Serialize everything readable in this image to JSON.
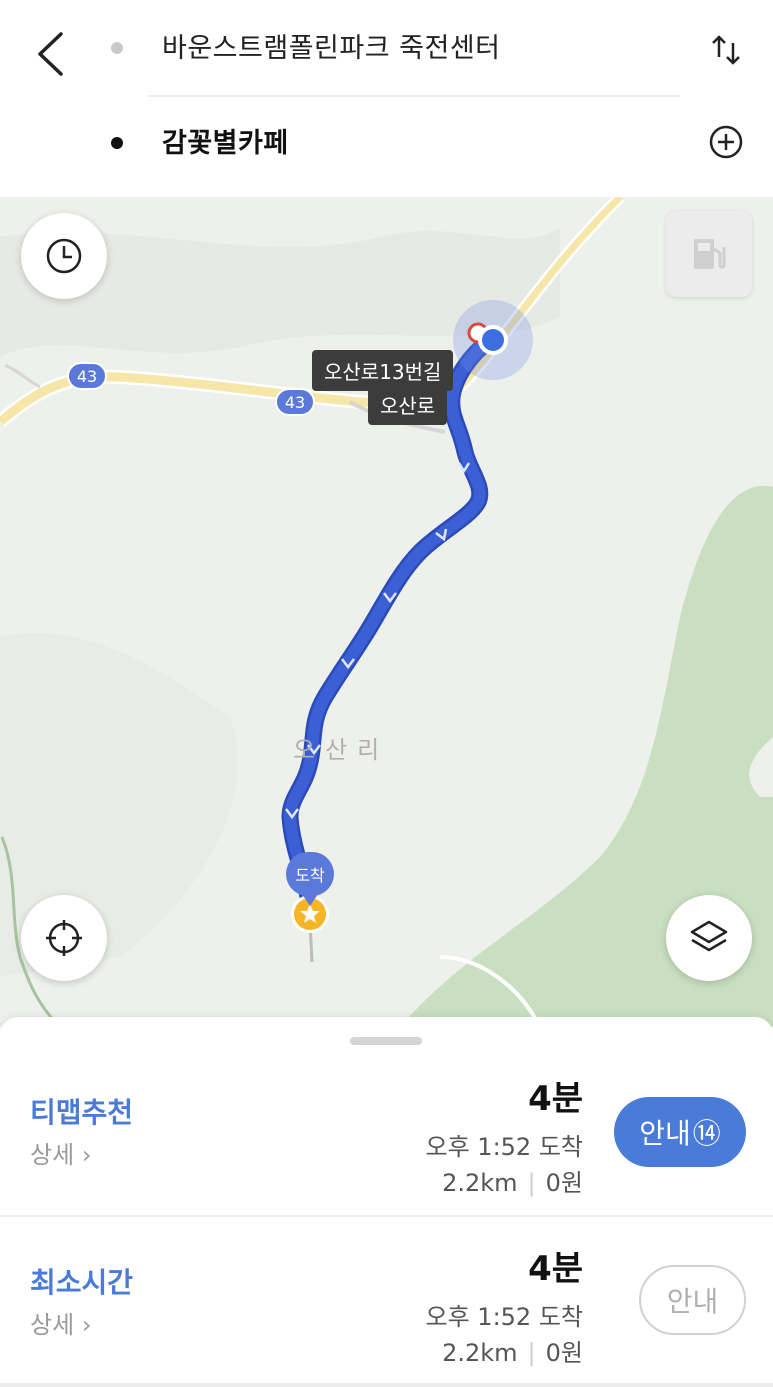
{
  "header": {
    "origin": "바운스트램폴린파크 죽전센터",
    "destination": "감꽃별카페"
  },
  "map": {
    "road_label_1": "오산로13번길",
    "road_label_2": "오산로",
    "route_number": "43",
    "place_name": "오산리",
    "arrive_label": "도착",
    "colors": {
      "route": "#3d5fd6",
      "forest": "#c9dfc0",
      "road_major": "#f6e7a8"
    }
  },
  "routes": [
    {
      "title": "티맵추천",
      "detail": "상세",
      "duration": "4분",
      "arrival": "오후 1:52 도착",
      "distance": "2.2km",
      "cost": "0원",
      "button": "안내",
      "button_badge": "⑭"
    },
    {
      "title": "최소시간",
      "detail": "상세",
      "duration": "4분",
      "arrival": "오후 1:52 도착",
      "distance": "2.2km",
      "cost": "0원",
      "button": "안내"
    }
  ],
  "icons": {
    "back": "back-arrow-icon",
    "swap": "swap-icon",
    "add": "add-waypoint-icon",
    "history": "clock-icon",
    "fuel": "fuel-icon",
    "locate": "crosshair-icon",
    "layers": "layers-icon"
  }
}
